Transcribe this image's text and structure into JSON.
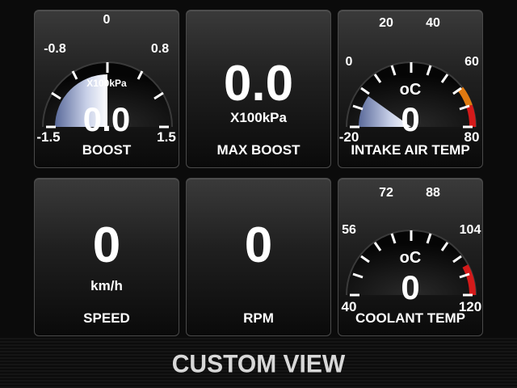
{
  "gauges": {
    "boost": {
      "min_label": "-1.5",
      "tick_labels": [
        "-0.8",
        "0",
        "0.8"
      ],
      "max_label": "1.5",
      "unit": "X100kPa",
      "value": "0.0",
      "label": "BOOST",
      "level": 0.5
    },
    "max_boost": {
      "value": "0.0",
      "unit": "X100kPa",
      "label": "MAX BOOST"
    },
    "intake_air_temp": {
      "min_label": "-20",
      "tick_labels": [
        "0",
        "20",
        "40",
        "60"
      ],
      "max_label": "80",
      "unit": "oC",
      "value": "0",
      "label": "INTAKE AIR TEMP",
      "level": 0.2
    },
    "speed": {
      "value": "0",
      "unit": "km/h",
      "label": "SPEED"
    },
    "rpm": {
      "value": "0",
      "label": "RPM"
    },
    "coolant_temp": {
      "min_label": "40",
      "tick_labels": [
        "56",
        "72",
        "88",
        "104"
      ],
      "max_label": "120",
      "unit": "oC",
      "value": "0",
      "label": "COOLANT TEMP",
      "level": 0
    }
  },
  "footer": {
    "title": "CUSTOM VIEW"
  },
  "colors": {
    "warning": "#e07a10",
    "danger": "#d41a1a",
    "fill": "#c8d0e8"
  }
}
